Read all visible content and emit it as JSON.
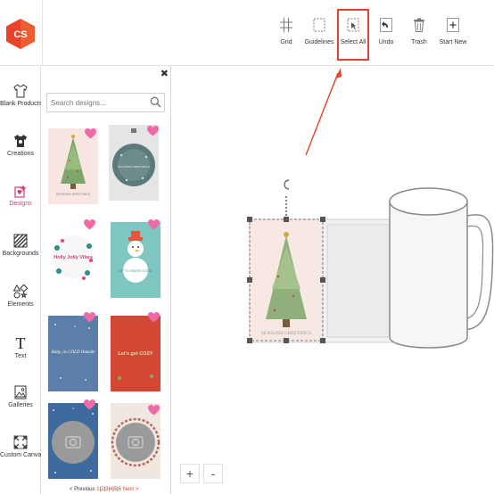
{
  "app": {
    "logo_text": "CS",
    "logo_color": "#e8432a"
  },
  "toolbar": {
    "grid": "Grid",
    "guidelines": "Guidelines",
    "select_all": "Select All",
    "undo": "Undo",
    "trash": "Trash",
    "start_new": "Start New"
  },
  "sidebar": {
    "items": [
      {
        "label": "Blank Products",
        "icon": "tshirt-icon"
      },
      {
        "label": "Creations",
        "icon": "tshirt-filled-icon"
      },
      {
        "label": "Designs",
        "icon": "designs-icon",
        "active": true
      },
      {
        "label": "Backgrounds",
        "icon": "backgrounds-icon"
      },
      {
        "label": "Elements",
        "icon": "elements-icon"
      },
      {
        "label": "Text",
        "icon": "text-icon"
      },
      {
        "label": "Galleries",
        "icon": "galleries-icon"
      },
      {
        "label": "Custom Canvas",
        "icon": "custom-canvas-icon"
      }
    ],
    "active_color": "#d93a73"
  },
  "designs_panel": {
    "search_placeholder": "Search designs...",
    "items": [
      {
        "text": "SEASONS GREETINGS"
      },
      {
        "text": "SEASONS GREETINGS"
      },
      {
        "text": "Holly Jolly Vibes"
      },
      {
        "text": "UP TO SNOW GOOD"
      },
      {
        "text": "Baby, its COLD Outside"
      },
      {
        "text": "Let's get COZY"
      },
      {
        "text": ""
      },
      {
        "text": ""
      }
    ],
    "pagination": {
      "prev": "< Previous",
      "pages": [
        "1",
        "2",
        "3",
        "4",
        "5",
        "6"
      ],
      "next": "Next >"
    }
  },
  "canvas": {
    "product": "mug",
    "design_text": "SEASONS GREETINGS",
    "zoom_in": "+",
    "zoom_out": "-"
  },
  "colors": {
    "accent": "#e8432a",
    "heart": "#f06aa8"
  }
}
